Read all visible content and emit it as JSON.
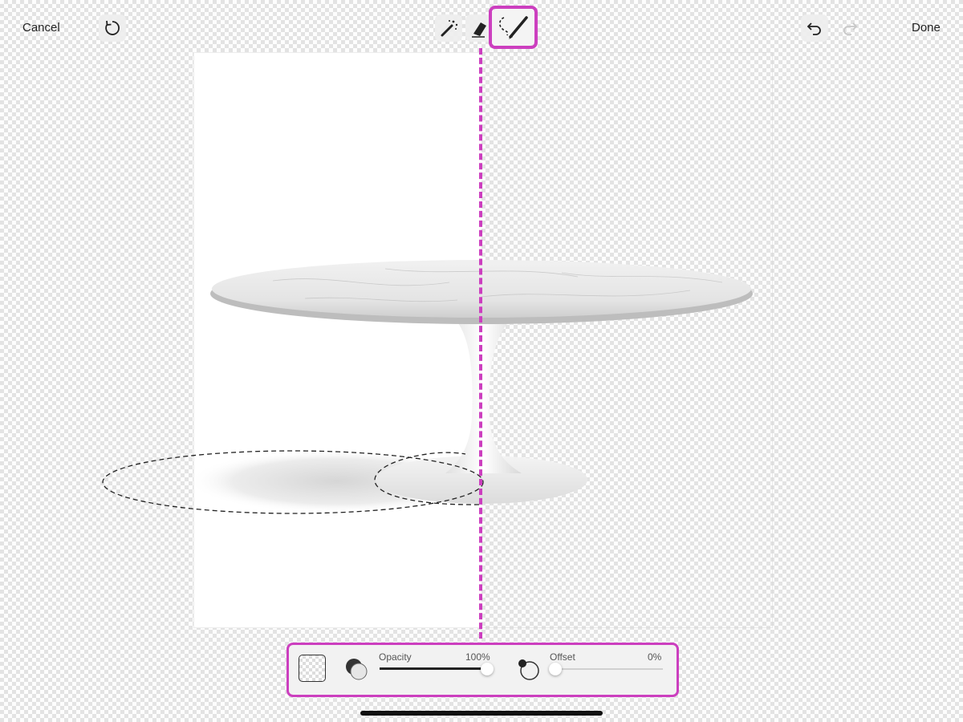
{
  "toolbar": {
    "cancel_label": "Cancel",
    "done_label": "Done",
    "tools": [
      {
        "icon": "magic-wand-icon",
        "selected": false
      },
      {
        "icon": "eraser-icon",
        "selected": false
      },
      {
        "icon": "lasso-brush-icon",
        "selected": true
      }
    ]
  },
  "panel": {
    "opacity_label": "Opacity",
    "opacity_value": "100%",
    "opacity_fraction": 1.0,
    "offset_label": "Offset",
    "offset_value": "0%",
    "offset_fraction": 0.0
  },
  "colors": {
    "accent": "#cc3fbf",
    "checker_light": "#fdfdfd",
    "checker_dark": "#e3e3e3"
  }
}
